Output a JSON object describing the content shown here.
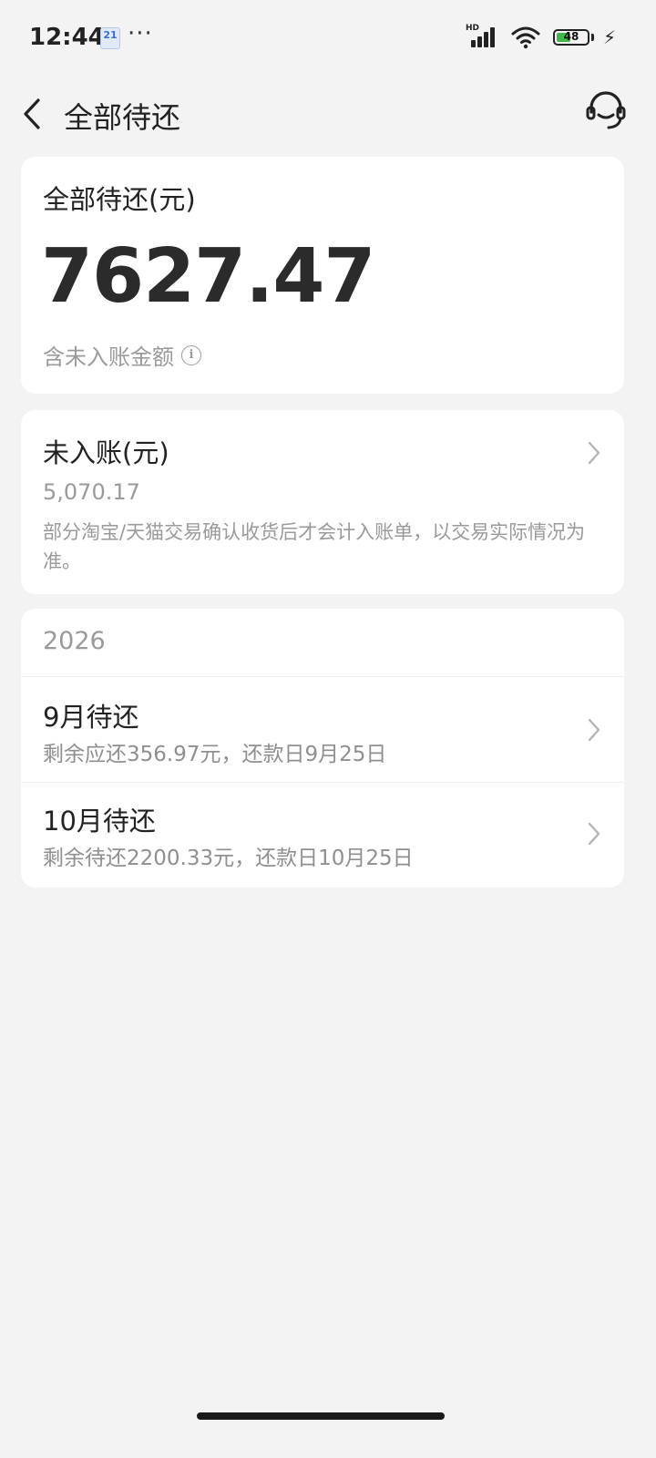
{
  "status_bar": {
    "time": "12:44",
    "calendar_day": "21",
    "more": "···",
    "network": "HD",
    "battery_level": "48",
    "battery_fraction": 0.48
  },
  "header": {
    "title": "全部待还"
  },
  "total_card": {
    "label": "全部待还(元)",
    "amount": "7627.47",
    "note": "含未入账金额",
    "info_symbol": "i"
  },
  "unbilled_card": {
    "label": "未入账(元)",
    "amount": "5,070.17",
    "description": "部分淘宝/天猫交易确认收货后才会计入账单，以交易实际情况为准。"
  },
  "schedule_card": {
    "year": "2026",
    "months": [
      {
        "title": "9月待还",
        "subtitle": "剩余应还356.97元，还款日9月25日"
      },
      {
        "title": "10月待还",
        "subtitle": "剩余待还2200.33元，还款日10月25日"
      }
    ]
  },
  "colors": {
    "background": "#f3f3f3",
    "card": "#ffffff",
    "primary_text": "#222222",
    "secondary_text": "#9a9a9a",
    "battery_fill": "#3fb84a"
  },
  "icons": [
    "back-arrow-icon",
    "customer-service-icon",
    "info-icon",
    "chevron-right-icon",
    "wifi-icon",
    "signal-icon",
    "battery-icon",
    "charging-bolt-icon",
    "calendar-icon"
  ]
}
